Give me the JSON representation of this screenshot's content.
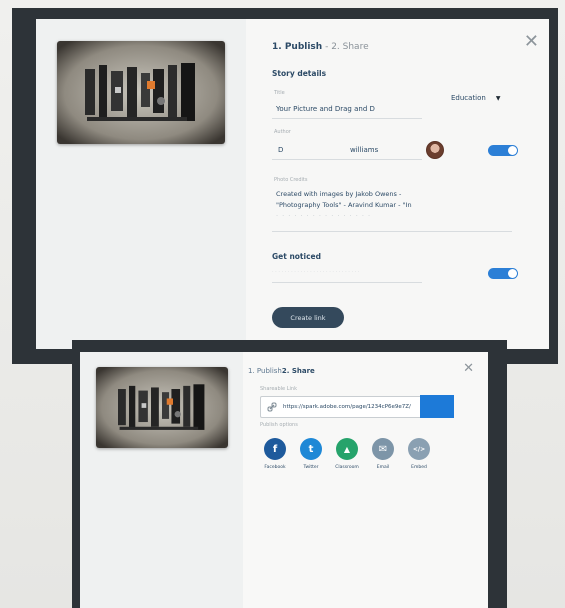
{
  "colors": {
    "frame": "#2d3338",
    "accent": "#2c7fd6",
    "heading": "#2c4a66",
    "button": "#34495c",
    "facebook": "#1e5a9c",
    "twitter": "#1e88d6",
    "classroom": "#26a36b",
    "email": "#7d95a8",
    "embed": "#8aa0b2"
  },
  "publish_dialog": {
    "step_publish": "1. Publish",
    "step_separator": " - ",
    "step_share": "2. Share",
    "close_icon": "✕",
    "story_details_heading": "Story details",
    "title_label": "Title",
    "title_value": "Your Picture and Drag and D",
    "category_value": "Education",
    "author_label": "Author",
    "author_first": "D",
    "author_last": "williams",
    "photo_credits_label": "Photo Credits",
    "credits_line1": "Created with images by Jakob Owens -",
    "credits_line2": "\"Photography Tools\" - Aravind Kumar - \"In",
    "get_noticed_heading": "Get noticed",
    "create_link_label": "Create link"
  },
  "share_dialog": {
    "step_publish": "1. Publish",
    "step_share": "2. Share",
    "close_icon": "✕",
    "shareable_link_label": "Shareable Link",
    "link_value": "https://spark.adobe.com/page/1234cP6e9e7Z/",
    "publish_options_label": "Publish options",
    "share_options": [
      {
        "label": "Facebook",
        "glyph": "f",
        "icon": "facebook-icon"
      },
      {
        "label": "Twitter",
        "glyph": "t",
        "icon": "twitter-icon"
      },
      {
        "label": "Classroom",
        "glyph": "▲",
        "icon": "classroom-icon"
      },
      {
        "label": "Email",
        "glyph": "✉",
        "icon": "email-icon"
      },
      {
        "label": "Embed",
        "glyph": "</>",
        "icon": "embed-icon"
      }
    ]
  }
}
